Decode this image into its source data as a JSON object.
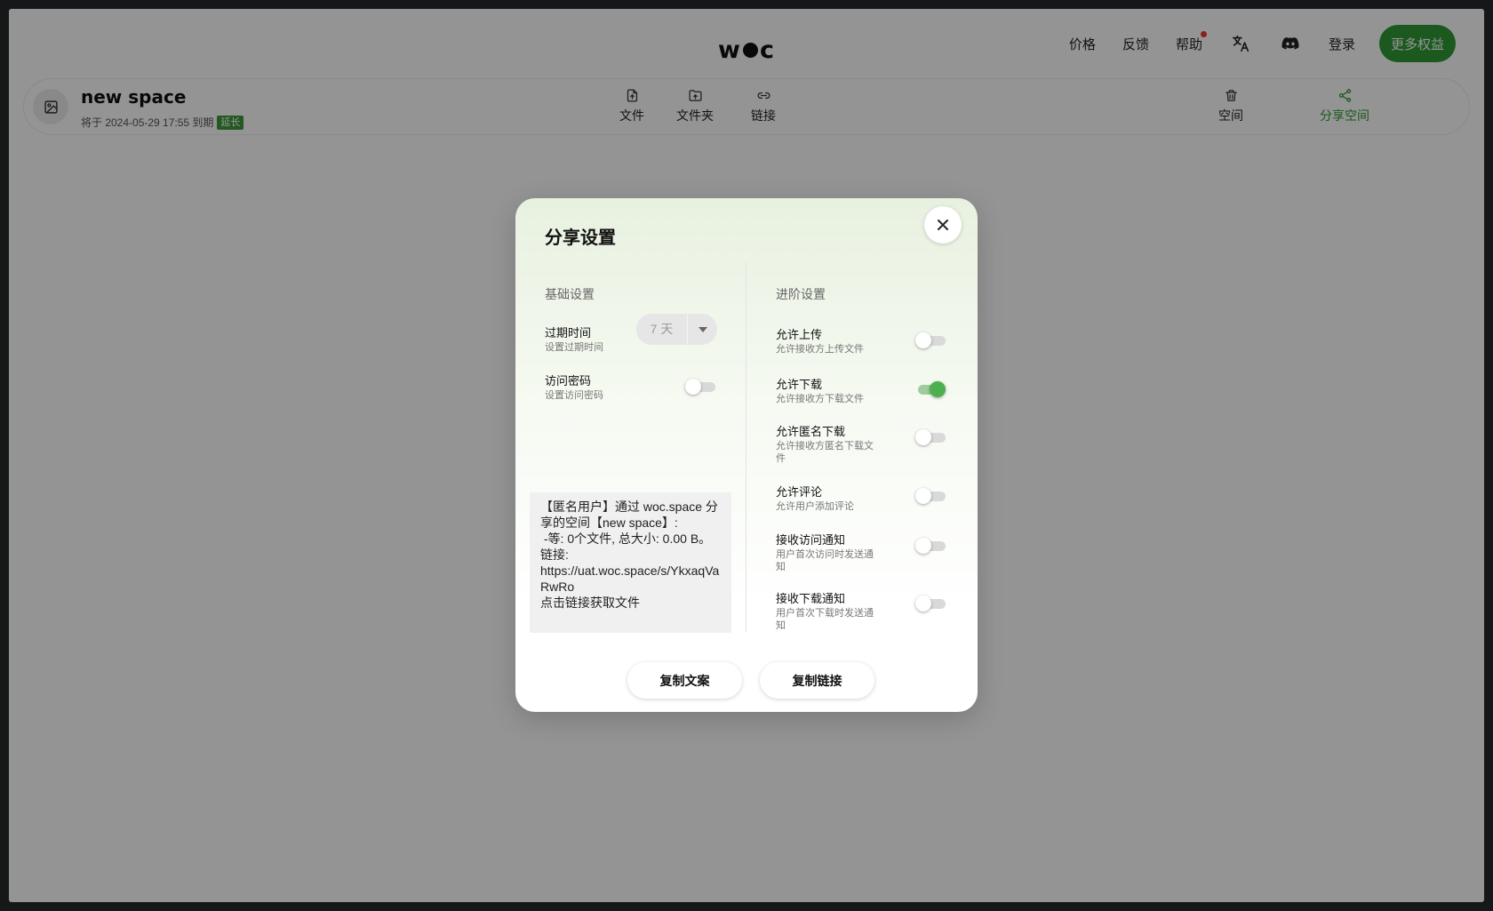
{
  "header": {
    "logo": {
      "left": "w",
      "right": "c"
    },
    "nav": {
      "pricing": "价格",
      "feedback": "反馈",
      "help": "帮助",
      "login": "登录",
      "upgrade": "更多权益"
    }
  },
  "space": {
    "title": "new space",
    "expiry_text": "将于 2024-05-29 17:55 到期",
    "extend_badge": "延长"
  },
  "toolbar": {
    "file": "文件",
    "folder": "文件夹",
    "link": "链接",
    "space": "空间",
    "share_space": "分享空间"
  },
  "modal": {
    "title": "分享设置",
    "basic": {
      "heading": "基础设置",
      "expiry_title": "过期时间",
      "expiry_desc": "设置过期时间",
      "expiry_value": "7 天",
      "password_title": "访问密码",
      "password_desc": "设置访问密码",
      "password_enabled": false
    },
    "share_text": "【匿名用户】通过 woc.space 分享的空间【new space】:\n -等: 0个文件, 总大小: 0.00 B。\n链接:\nhttps://uat.woc.space/s/YkxaqVaRwRo\n点击链接获取文件",
    "advanced": {
      "heading": "进阶设置",
      "items": [
        {
          "title": "允许上传",
          "desc": "允许接收方上传文件",
          "enabled": false
        },
        {
          "title": "允许下载",
          "desc": "允许接收方下载文件",
          "enabled": true
        },
        {
          "title": "允许匿名下载",
          "desc": "允许接收方匿名下载文件",
          "enabled": false
        },
        {
          "title": "允许评论",
          "desc": "允许用户添加评论",
          "enabled": false
        },
        {
          "title": "接收访问通知",
          "desc": "用户首次访问时发送通知",
          "enabled": false
        },
        {
          "title": "接收下载通知",
          "desc": "用户首次下载时发送通知",
          "enabled": false
        }
      ]
    },
    "buttons": {
      "copy_text": "复制文案",
      "copy_link": "复制链接"
    }
  },
  "colors": {
    "brand_green": "#2f9a35",
    "toggle_on": "#4caf50",
    "notification_dot": "#e53935"
  }
}
